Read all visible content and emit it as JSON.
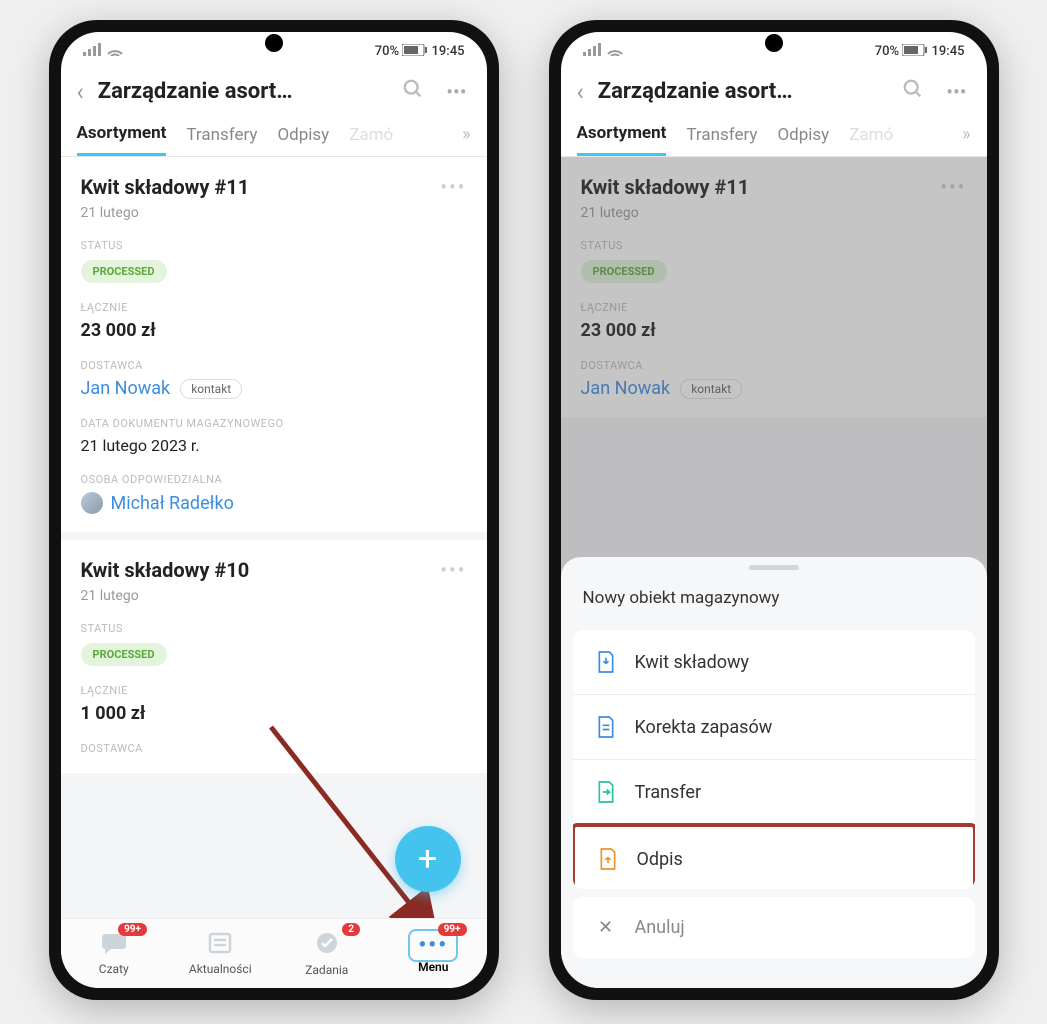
{
  "status": {
    "battery_text": "70%",
    "time": "19:45"
  },
  "header": {
    "title": "Zarządzanie asort…",
    "tabs": [
      "Asortyment",
      "Transfery",
      "Odpisy",
      "Zamó"
    ]
  },
  "cards": [
    {
      "title": "Kwit składowy #11",
      "date": "21 lutego",
      "status_label": "STATUS",
      "status_value": "PROCESSED",
      "total_label": "ŁĄCZNIE",
      "total_value": "23 000 zł",
      "supplier_label": "DOSTAWCA",
      "supplier_name": "Jan Nowak",
      "supplier_chip": "kontakt",
      "docdate_label": "DATA DOKUMENTU MAGAZYNOWEGO",
      "docdate_value": "21 lutego 2023 r.",
      "responsible_label": "OSOBA ODPOWIEDZIALNA",
      "responsible_name": "Michał Radełko"
    },
    {
      "title": "Kwit składowy #10",
      "date": "21 lutego",
      "status_label": "STATUS",
      "status_value": "PROCESSED",
      "total_label": "ŁĄCZNIE",
      "total_value": "1 000 zł",
      "supplier_label": "DOSTAWCA"
    }
  ],
  "nav": {
    "items": [
      {
        "label": "Czaty",
        "badge": "99+"
      },
      {
        "label": "Aktualności"
      },
      {
        "label": "Zadania",
        "badge": "2"
      },
      {
        "label": "Menu",
        "badge": "99+"
      }
    ]
  },
  "sheet": {
    "title": "Nowy obiekt magazynowy",
    "options": [
      {
        "label": "Kwit składowy",
        "color": "#3b8de0"
      },
      {
        "label": "Korekta zapasów",
        "color": "#3b8de0"
      },
      {
        "label": "Transfer",
        "color": "#2bbfa3"
      },
      {
        "label": "Odpis",
        "color": "#f0932b",
        "highlight": true
      }
    ],
    "cancel": "Anuluj"
  }
}
